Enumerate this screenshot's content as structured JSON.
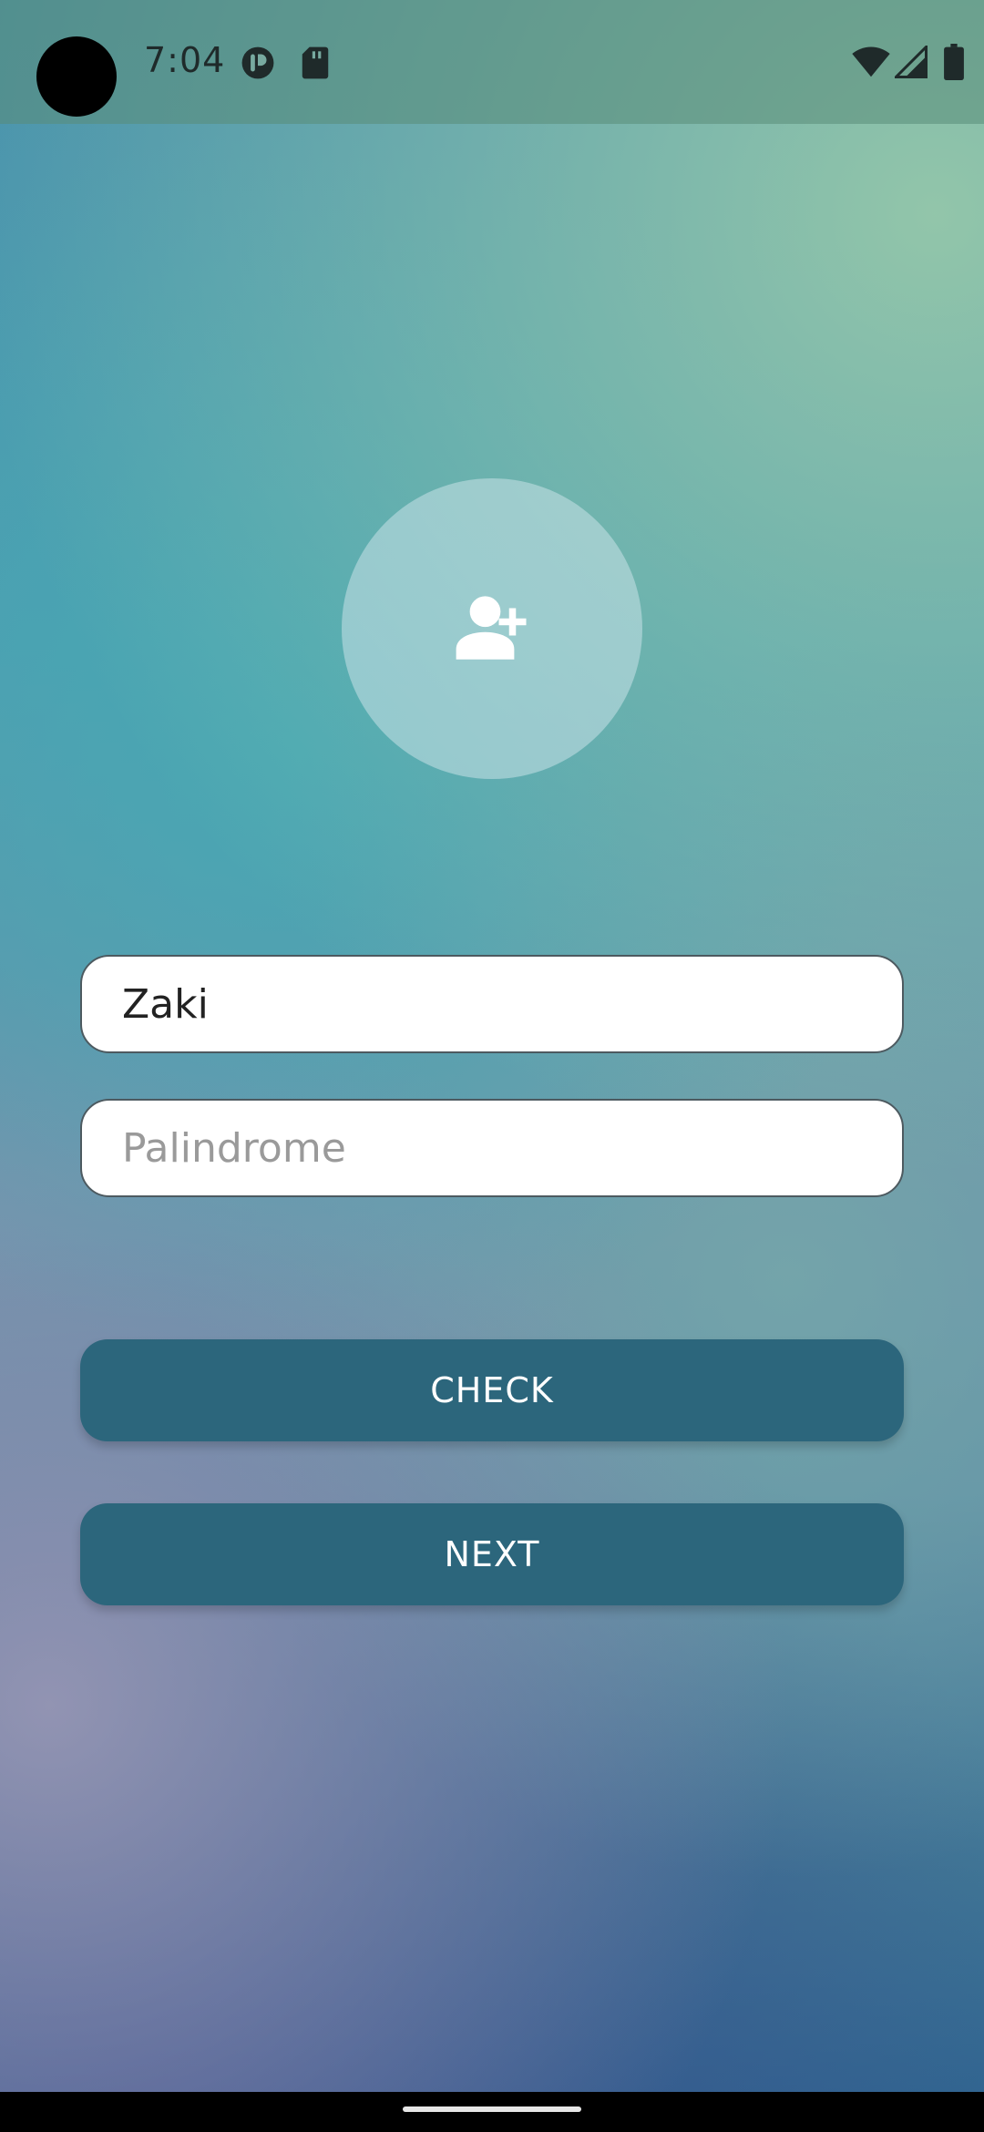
{
  "status_bar": {
    "time": "7:04",
    "icons": [
      "app-notification-icon",
      "sd-card-icon",
      "wifi-icon",
      "signal-icon",
      "battery-icon"
    ]
  },
  "avatar": {
    "icon": "add-user-icon"
  },
  "form": {
    "name_value": "Zaki",
    "palindrome_placeholder": "Palindrome"
  },
  "buttons": {
    "check_label": "CHECK",
    "next_label": "NEXT"
  },
  "colors": {
    "button": "#2c667c",
    "input_bg": "#ffffff"
  }
}
